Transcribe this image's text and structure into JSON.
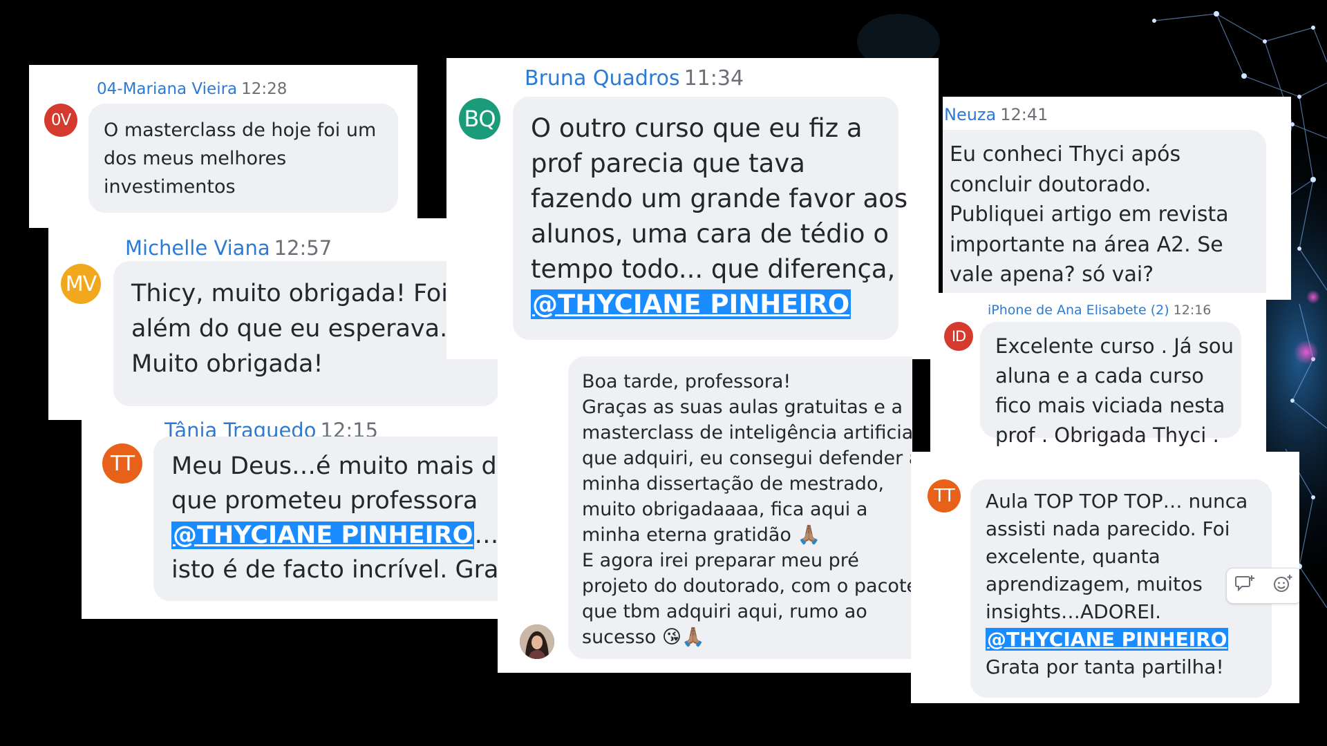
{
  "colors": {
    "background": "#000000",
    "card": "#ffffff",
    "bubble": "#eef0f4",
    "sender_name": "#2b7bd6",
    "mention_bg": "#1a8cff"
  },
  "messages": [
    {
      "sender": "04-Mariana Vieira",
      "time": "12:28",
      "avatar_initials": "0V",
      "avatar_color": "#d43b2e",
      "lines": [
        "O masterclass de hoje foi um",
        "dos meus melhores",
        "investimentos"
      ]
    },
    {
      "sender": "Michelle Viana",
      "time": "12:57",
      "avatar_initials": "MV",
      "avatar_color": "#f2a81d",
      "lines": [
        "Thicy, muito obrigada! Foi",
        "além do que eu esperava.",
        "Muito obrigada!"
      ]
    },
    {
      "sender": "Tânia Traguedo",
      "time": "12:15",
      "avatar_initials": "TT",
      "avatar_color": "#e8611a",
      "lines": [
        "Meu Deus…é muito mais do",
        "que prometeu professora"
      ],
      "mention": "@THYCIANE PINHEIRO",
      "after_mention": "…",
      "last_line": "isto é de facto incrível. Grata"
    },
    {
      "sender": "Bruna Quadros",
      "time": "11:34",
      "avatar_initials": "BQ",
      "avatar_color": "#1a9c7a",
      "lines": [
        "O outro curso que eu fiz a",
        "prof parecia que tava",
        "fazendo um grande favor aos",
        "alunos, uma cara de tédio o",
        "tempo todo... que diferença,"
      ],
      "mention": "@THYCIANE PINHEIRO"
    },
    {
      "avatar_icon": "profile-photo",
      "lines": [
        "Boa tarde, professora!",
        "Graças as suas aulas gratuitas e a",
        "masterclass de inteligência artificial",
        "que adquiri, eu consegui defender a",
        "minha dissertação de mestrado,",
        "muito obrigadaaaa, fica aqui a",
        "minha eterna gratidão 🙏🏽",
        "E agora irei preparar meu pré",
        "projeto do doutorado, com o pacote",
        "que tbm adquiri aqui, rumo ao",
        "sucesso 😘🙏🏽"
      ]
    },
    {
      "sender": "Neuza",
      "time": "12:41",
      "lines": [
        "Eu conheci Thyci após",
        "concluir doutorado.",
        "Publiquei artigo em revista",
        "importante na área A2. Se",
        "vale  apena? só vai?"
      ]
    },
    {
      "sender": "iPhone de Ana Elisabete (2)",
      "time": "12:16",
      "avatar_initials": "ID",
      "avatar_color": "#d43b2e",
      "lines": [
        "Excelente curso . Já sou",
        "aluna e a cada curso",
        "fico mais viciada nesta",
        "prof . Obrigada Thyci ."
      ]
    },
    {
      "avatar_initials": "TT",
      "avatar_color": "#e8611a",
      "lines": [
        "Aula TOP TOP TOP… nunca",
        "assisti nada parecido. Foi",
        "excelente, quanta",
        "aprendizagem, muitos",
        "insights…ADOREI."
      ],
      "mention": "@THYCIANE PINHEIRO",
      "last_line": "Grata por tanta partilha!",
      "reactions": [
        "comment-add-icon",
        "emoji-add-icon"
      ]
    }
  ]
}
